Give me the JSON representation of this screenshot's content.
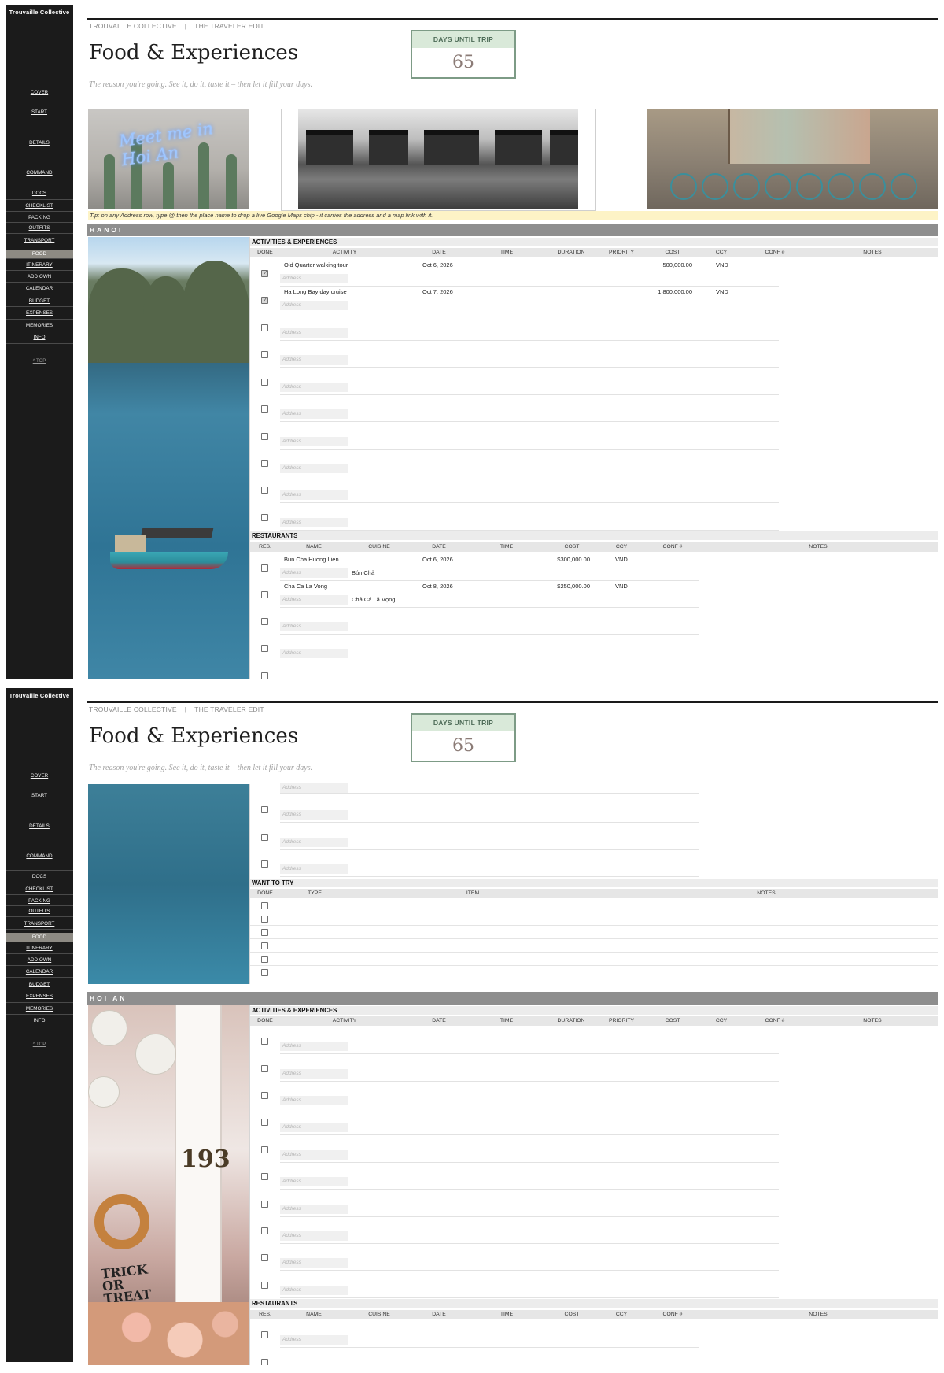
{
  "sidebar": {
    "brand": "Trouvaille Collective",
    "items": [
      {
        "label": "COVER"
      },
      {
        "label": "START"
      },
      {
        "label": "DETAILS"
      },
      {
        "label": "COMMAND"
      },
      {
        "label": "DOCS"
      },
      {
        "label": "CHECKLIST"
      },
      {
        "label": "PACKING"
      },
      {
        "label": "OUTFITS"
      },
      {
        "label": "TRANSPORT"
      },
      {
        "label": "FOOD",
        "active": true
      },
      {
        "label": "ITINERARY"
      },
      {
        "label": "ADD OWN"
      },
      {
        "label": "CALENDAR"
      },
      {
        "label": "BUDGET"
      },
      {
        "label": "EXPENSES"
      },
      {
        "label": "MEMORIES"
      },
      {
        "label": "INFO"
      }
    ],
    "top_link": "^ TOP"
  },
  "header": {
    "breadcrumb_1": "TROUVAILLE COLLECTIVE",
    "breadcrumb_sep": "|",
    "breadcrumb_2": "THE TRAVELER EDIT",
    "title": "Food & Experiences",
    "subtitle": "The reason you're going. See it, do it, taste it – then let it fill your days."
  },
  "countdown": {
    "label": "DAYS UNTIL TRIP",
    "value": "65"
  },
  "banner": {
    "neon_text": "Meet me in Hoi An"
  },
  "tip": "Tip: on any Address row, type  @  then the place name to drop a live Google Maps chip - it carries the address and a map link with it.",
  "address_placeholder": "Address",
  "activity_columns": [
    "DONE",
    "ACTIVITY",
    "DATE",
    "TIME",
    "DURATION",
    "PRIORITY",
    "COST",
    "CCY",
    "CONF #",
    "NOTES"
  ],
  "restaurant_columns": [
    "RES.",
    "NAME",
    "CUISINE",
    "DATE",
    "TIME",
    "COST",
    "CCY",
    "CONF #",
    "NOTES"
  ],
  "want_columns": [
    "DONE",
    "TYPE",
    "ITEM",
    "NOTES"
  ],
  "sections": {
    "activities": "ACTIVITIES & EXPERIENCES",
    "restaurants": "RESTAURANTS",
    "want": "WANT TO TRY"
  },
  "cities": {
    "hanoi": {
      "name": "HANOI",
      "activities": [
        {
          "done": true,
          "activity": "Old Quarter walking tour",
          "date": "Oct 6, 2026",
          "cost": "500,000.00",
          "ccy": "VND"
        },
        {
          "done": true,
          "activity": "Ha Long Bay day cruise",
          "date": "Oct 7, 2026",
          "cost": "1,800,000.00",
          "ccy": "VND"
        }
      ],
      "restaurants": [
        {
          "name": "Bun Cha Huong Lien",
          "cuisine": "Bún Chả",
          "date": "Oct 6, 2026",
          "cost": "$300,000.00",
          "ccy": "VND"
        },
        {
          "name": "Cha Ca La Vong",
          "cuisine": "Chả Cá Lã Vọng",
          "date": "Oct 8, 2026",
          "cost": "$250,000.00",
          "ccy": "VND"
        }
      ]
    },
    "hoian": {
      "name": "HOI AN",
      "house_number": "193",
      "sign_text": "TRICK OR TREAT"
    }
  }
}
